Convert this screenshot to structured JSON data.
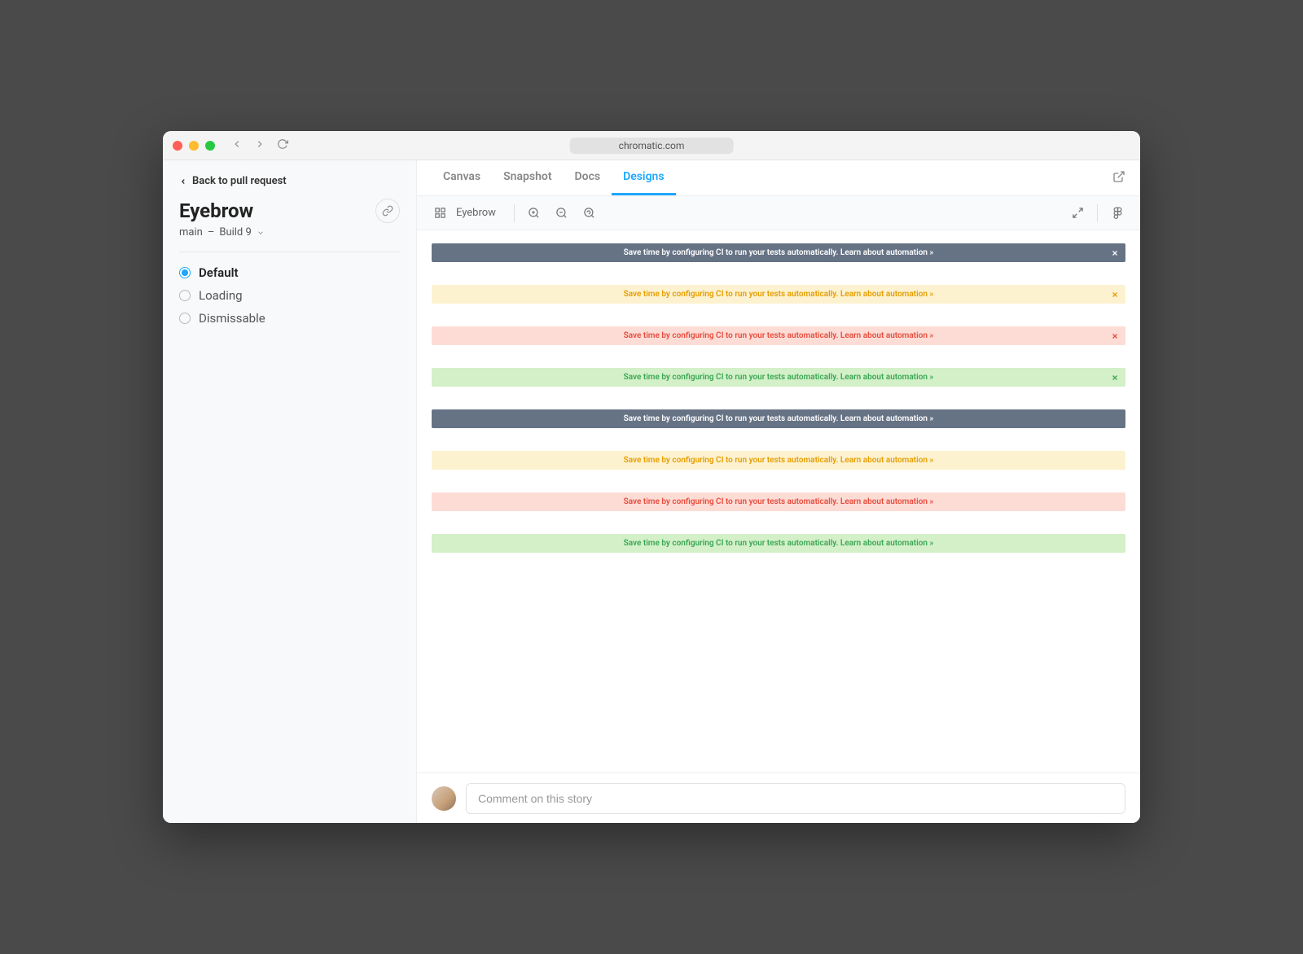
{
  "browser": {
    "url": "chromatic.com"
  },
  "sidebar": {
    "back_label": "Back to pull request",
    "title": "Eyebrow",
    "branch": "main",
    "separator": "–",
    "build": "Build 9",
    "stories": [
      {
        "label": "Default",
        "active": true
      },
      {
        "label": "Loading",
        "active": false
      },
      {
        "label": "Dismissable",
        "active": false
      }
    ]
  },
  "tabs": [
    {
      "label": "Canvas",
      "active": false
    },
    {
      "label": "Snapshot",
      "active": false
    },
    {
      "label": "Docs",
      "active": false
    },
    {
      "label": "Designs",
      "active": true
    }
  ],
  "toolbar": {
    "crumb": "Eyebrow"
  },
  "banners": [
    {
      "variant": "dark",
      "text": "Save time by configuring CI to run your tests automatically. Learn about automation »",
      "dismissable": true
    },
    {
      "variant": "warn",
      "text": "Save time by configuring CI to run your tests automatically. Learn about automation »",
      "dismissable": true
    },
    {
      "variant": "err",
      "text": "Save time by configuring CI to run your tests automatically. Learn about automation »",
      "dismissable": true
    },
    {
      "variant": "ok",
      "text": "Save time by configuring CI to run your tests automatically. Learn about automation »",
      "dismissable": true
    },
    {
      "variant": "dark",
      "text": "Save time by configuring CI to run your tests automatically. Learn about automation »",
      "dismissable": false
    },
    {
      "variant": "warn",
      "text": "Save time by configuring CI to run your tests automatically. Learn about automation »",
      "dismissable": false
    },
    {
      "variant": "err",
      "text": "Save time by configuring CI to run your tests automatically. Learn about automation »",
      "dismissable": false
    },
    {
      "variant": "ok",
      "text": "Save time by configuring CI to run your tests automatically. Learn about automation »",
      "dismissable": false
    }
  ],
  "comment": {
    "placeholder": "Comment on this story"
  }
}
